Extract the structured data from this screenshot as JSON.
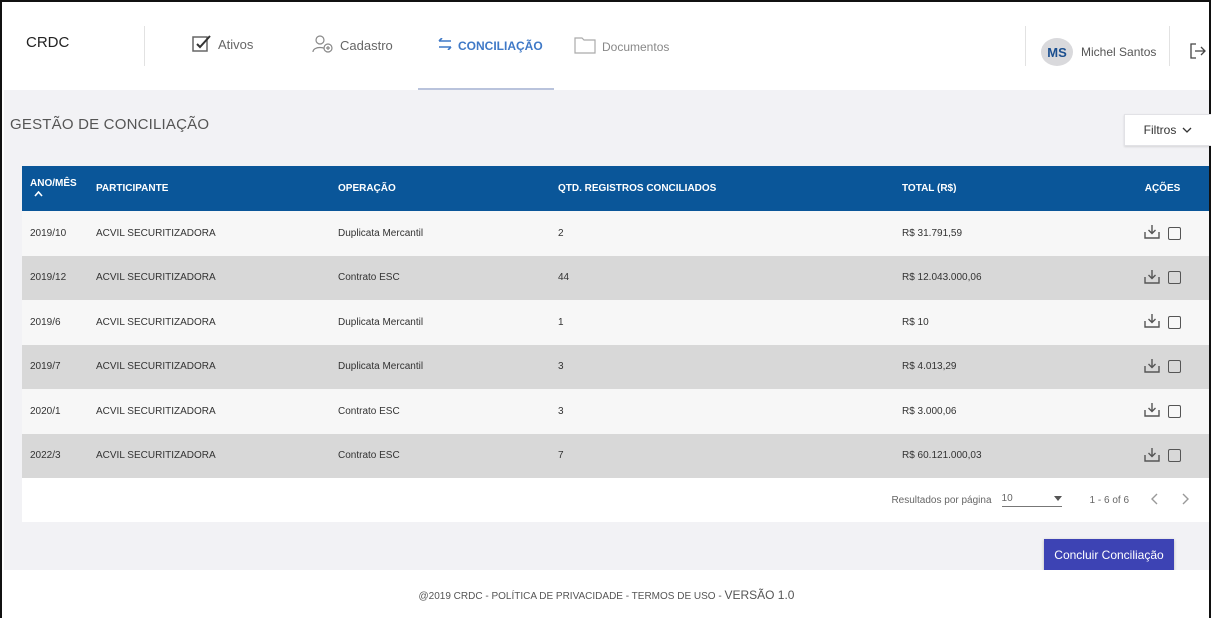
{
  "header": {
    "brand": "CRDC",
    "nav": [
      {
        "label": "Ativos",
        "icon": "edit-checkbox-icon"
      },
      {
        "label": "Cadastro",
        "icon": "users-add-icon"
      },
      {
        "label": "CONCILIAÇÃO",
        "icon": "reconcile-icon"
      },
      {
        "label": "Documentos",
        "icon": "folder-icon"
      }
    ],
    "user": {
      "initials": "MS",
      "name": "Michel Santos"
    }
  },
  "page": {
    "title": "GESTÃO DE CONCILIAÇÃO",
    "filters_label": "Filtros"
  },
  "table": {
    "columns": {
      "ano": "ANO/MÊS",
      "participante": "PARTICIPANTE",
      "operacao": "OPERAÇÃO",
      "qtd": "QTD. REGISTROS CONCILIADOS",
      "total": "TOTAL (R$)",
      "acoes": "AÇÕES"
    },
    "rows": [
      {
        "ano": "2019/10",
        "participante": "ACVIL SECURITIZADORA",
        "operacao": "Duplicata Mercantil",
        "qtd": "2",
        "total": "R$ 31.791,59"
      },
      {
        "ano": "2019/12",
        "participante": "ACVIL SECURITIZADORA",
        "operacao": "Contrato ESC",
        "qtd": "44",
        "total": "R$ 12.043.000,06"
      },
      {
        "ano": "2019/6",
        "participante": "ACVIL SECURITIZADORA",
        "operacao": "Duplicata Mercantil",
        "qtd": "1",
        "total": "R$ 10"
      },
      {
        "ano": "2019/7",
        "participante": "ACVIL SECURITIZADORA",
        "operacao": "Duplicata Mercantil",
        "qtd": "3",
        "total": "R$ 4.013,29"
      },
      {
        "ano": "2020/1",
        "participante": "ACVIL SECURITIZADORA",
        "operacao": "Contrato ESC",
        "qtd": "3",
        "total": "R$ 3.000,06"
      },
      {
        "ano": "2022/3",
        "participante": "ACVIL SECURITIZADORA",
        "operacao": "Contrato ESC",
        "qtd": "7",
        "total": "R$ 60.121.000,03"
      }
    ],
    "pager": {
      "label": "Resultados por página",
      "per_page": "10",
      "range": "1 - 6 of 6"
    }
  },
  "actions": {
    "concluir": "Concluir Conciliação"
  },
  "footer": {
    "text": "@2019 CRDC - POLÍTICA DE PRIVACIDADE - TERMOS DE USO - ",
    "version": "VERSÃO 1.0"
  },
  "colors": {
    "header_bg": "#0a5699",
    "primary_button": "#3d43b4",
    "active_nav": "#3f79c7"
  }
}
